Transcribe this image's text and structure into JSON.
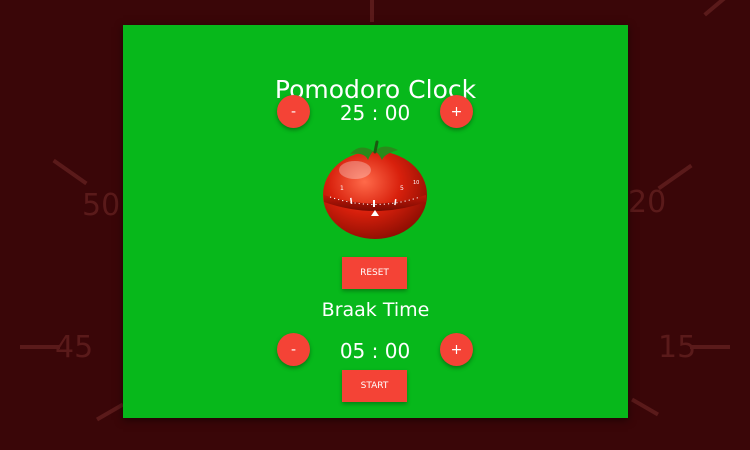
{
  "background": {
    "labels": [
      "50",
      "45",
      "20",
      "15"
    ],
    "color": "#3a0608"
  },
  "app": {
    "title": "Pomodoro Clock",
    "accent": "#07b81b",
    "button_color": "#f44336"
  },
  "session": {
    "decrement_label": "-",
    "time": "25 : 00",
    "increment_label": "+"
  },
  "tomato": {
    "icon": "tomato-timer-icon",
    "dial_numbers": [
      "1",
      "5",
      "10"
    ]
  },
  "reset_label": "RESET",
  "break": {
    "title": "Braak Time",
    "decrement_label": "-",
    "time": "05 : 00",
    "increment_label": "+"
  },
  "start_label": "START"
}
